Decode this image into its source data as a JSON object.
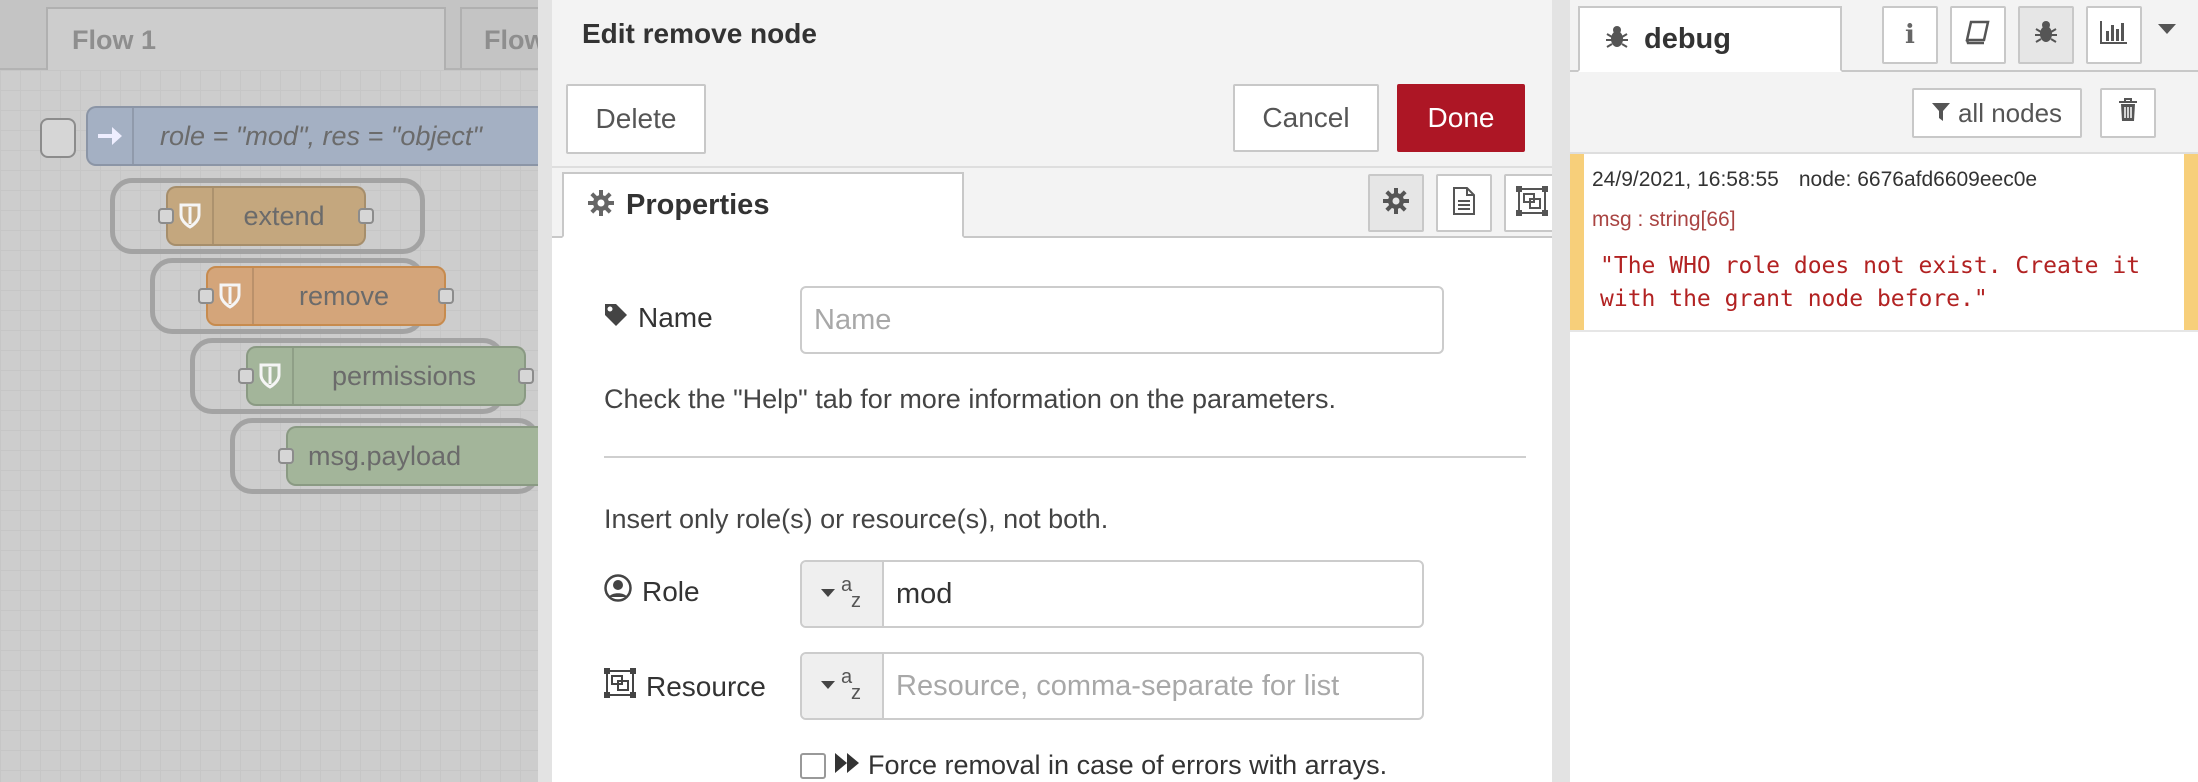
{
  "workspace": {
    "tabs": [
      {
        "label": "Flow 1"
      },
      {
        "label": "Flow"
      }
    ],
    "nodes": [
      {
        "label": "role = \"mod\", res = \"object\"",
        "kind": "inject",
        "color": "#a4b0c3"
      },
      {
        "label": "extend",
        "kind": "function",
        "color": "#c4a77e"
      },
      {
        "label": "remove",
        "kind": "function",
        "color": "#d4a57a"
      },
      {
        "label": "permissions",
        "kind": "function",
        "color": "#a3b59a"
      },
      {
        "label": "msg.payload",
        "kind": "debug",
        "color": "#a3b59a"
      }
    ]
  },
  "tray": {
    "title": "Edit remove node",
    "delete_label": "Delete",
    "cancel_label": "Cancel",
    "done_label": "Done",
    "tab_properties": "Properties",
    "name_label": "Name",
    "name_placeholder": "Name",
    "help_text": "Check the \"Help\" tab for more information on the parameters.",
    "insert_text": "Insert only role(s) or resource(s), not both.",
    "role_label": "Role",
    "role_value": "mod",
    "resource_label": "Resource",
    "resource_placeholder": "Resource, comma-separate for list",
    "force_label": "Force removal in case of errors with arrays.",
    "force_checked": false
  },
  "sidebar": {
    "tab_debug": "debug",
    "filter_label": "all nodes",
    "message": {
      "timestamp": "24/9/2021, 16:58:55",
      "node": "node: 6676afd6609eec0e",
      "type": "msg : string[66]",
      "value": "\"The WHO role does not exist. Create it with the grant node before.\""
    }
  },
  "colors": {
    "done": "#ad1625",
    "debug_marker": "#f7cf7a",
    "string_value": "#b22222"
  }
}
